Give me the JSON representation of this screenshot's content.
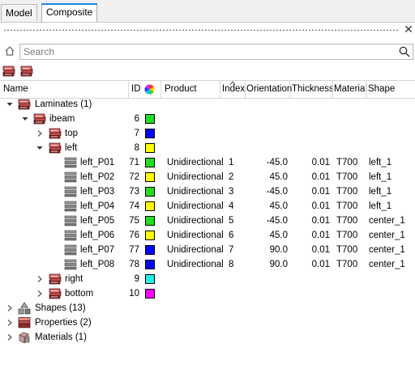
{
  "tabs": [
    {
      "label": "Model",
      "active": false
    },
    {
      "label": "Composite",
      "active": true
    }
  ],
  "search": {
    "placeholder": "Search"
  },
  "columns": {
    "name": "Name",
    "id": "ID",
    "product": "Product",
    "index": "Index",
    "orientation": "Orientation",
    "thickness": "Thickness",
    "material": "Material",
    "shape": "Shape"
  },
  "tree": {
    "laminates": {
      "label": "Laminates (1)"
    },
    "ibeam": {
      "label": "ibeam",
      "id": "6",
      "color": "#22dd22"
    },
    "top": {
      "label": "top",
      "id": "7",
      "color": "#0000ff"
    },
    "left": {
      "label": "left",
      "id": "8",
      "color": "#ffff00"
    },
    "plies": [
      {
        "name": "left_P01",
        "id": "71",
        "color": "#22dd22",
        "product": "Unidirectional",
        "index": "1",
        "orientation": "-45.0",
        "thickness": "0.01",
        "material": "T700",
        "shape": "left_1"
      },
      {
        "name": "left_P02",
        "id": "72",
        "color": "#ffff00",
        "product": "Unidirectional",
        "index": "2",
        "orientation": "45.0",
        "thickness": "0.01",
        "material": "T700",
        "shape": "left_1"
      },
      {
        "name": "left_P03",
        "id": "73",
        "color": "#22dd22",
        "product": "Unidirectional",
        "index": "3",
        "orientation": "-45.0",
        "thickness": "0.01",
        "material": "T700",
        "shape": "left_1"
      },
      {
        "name": "left_P04",
        "id": "74",
        "color": "#ffff00",
        "product": "Unidirectional",
        "index": "4",
        "orientation": "45.0",
        "thickness": "0.01",
        "material": "T700",
        "shape": "left_1"
      },
      {
        "name": "left_P05",
        "id": "75",
        "color": "#22dd22",
        "product": "Unidirectional",
        "index": "5",
        "orientation": "-45.0",
        "thickness": "0.01",
        "material": "T700",
        "shape": "center_1"
      },
      {
        "name": "left_P06",
        "id": "76",
        "color": "#ffff00",
        "product": "Unidirectional",
        "index": "6",
        "orientation": "45.0",
        "thickness": "0.01",
        "material": "T700",
        "shape": "center_1"
      },
      {
        "name": "left_P07",
        "id": "77",
        "color": "#0000ff",
        "product": "Unidirectional",
        "index": "7",
        "orientation": "90.0",
        "thickness": "0.01",
        "material": "T700",
        "shape": "center_1"
      },
      {
        "name": "left_P08",
        "id": "78",
        "color": "#0000ff",
        "product": "Unidirectional",
        "index": "8",
        "orientation": "90.0",
        "thickness": "0.01",
        "material": "T700",
        "shape": "center_1"
      }
    ],
    "right": {
      "label": "right",
      "id": "9",
      "color": "#22eeee"
    },
    "bottom": {
      "label": "bottom",
      "id": "10",
      "color": "#ff00ff"
    },
    "shapes": {
      "label": "Shapes (13)"
    },
    "properties": {
      "label": "Properties (2)"
    },
    "materials": {
      "label": "Materials (1)"
    }
  }
}
